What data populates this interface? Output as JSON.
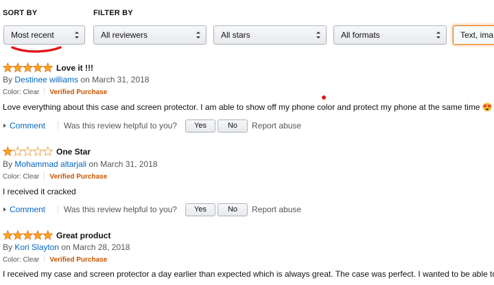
{
  "sort": {
    "label": "SORT BY",
    "value": "Most recent"
  },
  "filter": {
    "label": "FILTER BY",
    "reviewers": "All reviewers",
    "stars": "All stars",
    "formats": "All formats",
    "media": "Text, ima"
  },
  "annotation_color": "#e0191e",
  "colors": {
    "star": "#ffa41c",
    "link": "#0066c0",
    "verified": "#c45500"
  },
  "reviews": [
    {
      "rating": 5,
      "title": "Love it !!!",
      "by_prefix": "By",
      "author": "Destinee williams",
      "date": "on March 31, 2018",
      "color": "Color: Clear",
      "verified": "Verified Purchase",
      "text": "Love everything about this case and screen protector. I am able to show off my phone color and protect my phone at the same time 😍",
      "comment": "Comment",
      "helpful": "Was this review helpful to you?",
      "yes": "Yes",
      "no": "No",
      "report": "Report abuse"
    },
    {
      "rating": 1,
      "title": "One Star",
      "by_prefix": "By",
      "author": "Mohammad altarjali",
      "date": "on March 31, 2018",
      "color": "Color: Clear",
      "verified": "Verified Purchase",
      "text": "I received it cracked",
      "comment": "Comment",
      "helpful": "Was this review helpful to you?",
      "yes": "Yes",
      "no": "No",
      "report": "Report abuse"
    },
    {
      "rating": 5,
      "title": "Great product",
      "by_prefix": "By",
      "author": "Kori Slayton",
      "date": "on March 28, 2018",
      "color": "Color: Clear",
      "verified": "Verified Purchase",
      "text": "I received my case and screen protector a day earlier than expected which is always great. The case was perfect. I wanted to be able to"
    }
  ]
}
